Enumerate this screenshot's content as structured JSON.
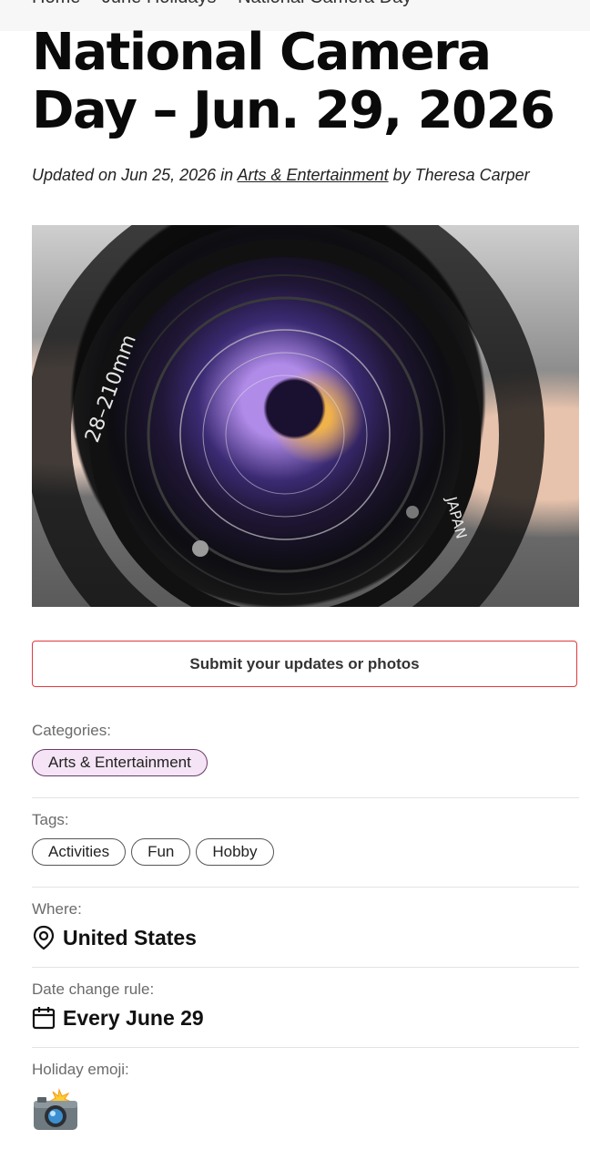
{
  "breadcrumb": [
    "Home",
    "June Holidays",
    "National Camera Day"
  ],
  "article": {
    "title": "National Camera Day – Jun. 29, 2026",
    "byline_prefix": "Updated on Jun 25, 2026 in ",
    "byline_category": "Arts & Entertainment",
    "byline_suffix": " by Theresa Carper"
  },
  "hero": {
    "lens_text_left": "28–210mm",
    "lens_text_right": "JAPAN"
  },
  "submit_button": {
    "label": "Submit your updates or photos"
  },
  "categories": {
    "label": "Categories:",
    "items": [
      "Arts & Entertainment"
    ]
  },
  "tags": {
    "label": "Tags:",
    "items": [
      "Activities",
      "Fun",
      "Hobby"
    ]
  },
  "where": {
    "label": "Where:",
    "value": "United States",
    "icon": "location-pin-icon"
  },
  "date_rule": {
    "label": "Date change rule:",
    "value": "Every June 29",
    "icon": "calendar-icon"
  },
  "emoji": {
    "label": "Holiday emoji:",
    "icon": "camera-with-flash-icon"
  },
  "colors": {
    "accent_border": "#e0393e",
    "category_pill_bg": "#f5e4f5",
    "label_gray": "#6b6b6b"
  }
}
